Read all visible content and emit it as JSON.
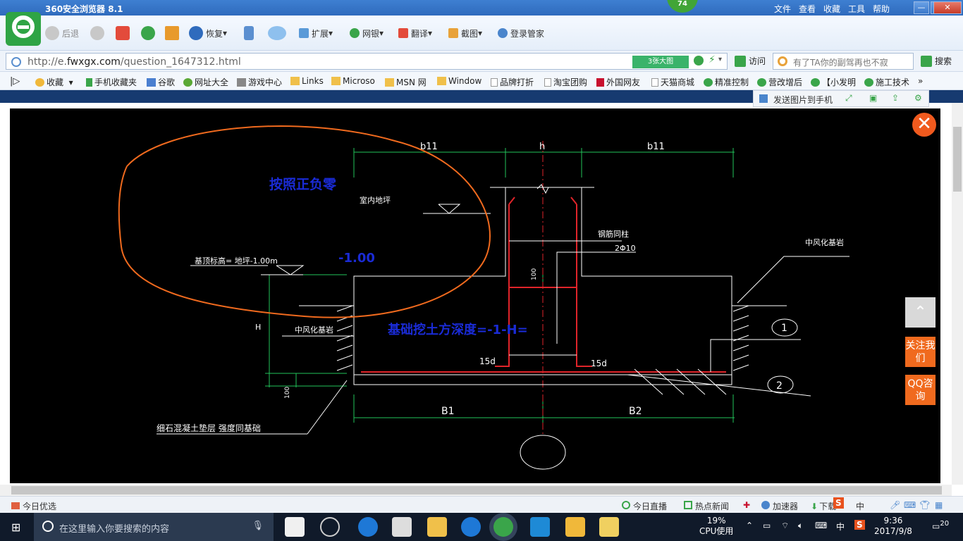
{
  "titlebar": {
    "title": "360安全浏览器 8.1",
    "badge": "74",
    "menu": [
      "文件",
      "查看",
      "收藏",
      "工具",
      "帮助"
    ]
  },
  "toolbar": {
    "back": "后退",
    "restore": "恢复",
    "extend": "扩展",
    "bank": "网银",
    "translate": "翻译",
    "screenshot": "截图",
    "login": "登录管家"
  },
  "address": {
    "url_prefix": "http://e.",
    "url_domain": "fwxgx.com",
    "url_path": "/question_1647312.html",
    "big_image": "3张大图",
    "visit": "访问",
    "search_placeholder": "有了TA你的副驾再也不寂",
    "search_btn": "搜索"
  },
  "favorites": [
    "收藏",
    "手机收藏夹",
    "谷歌",
    "网址大全",
    "游戏中心",
    "Links",
    "Microso",
    "MSN 网",
    "Window",
    "品牌打折",
    "淘宝团购",
    "外国网友",
    "天猫商城",
    "精准控制",
    "营改增后",
    "【小发明",
    "施工技术"
  ],
  "sendbar": {
    "label": "发送图片到手机"
  },
  "drawing": {
    "annot_text": "按照正负零",
    "annot_value": "-1.00",
    "annot_depth": "基础挖土方深度=-1-H=",
    "dim_b11_left": "b11",
    "dim_h": "h",
    "dim_b11_right": "b11",
    "indoor_floor": "室内地坪",
    "base_elev": "基顶标高= 地坪-1.00m",
    "steel_col": "钢筋同柱",
    "rebar": "2Φ10",
    "weathered_right": "中风化基岩",
    "weathered_left": "中风化基岩",
    "dim_100_top": "100",
    "dim_H": "H",
    "dim_100_bot": "100",
    "anchor_left": "15d",
    "anchor_right": "15d",
    "marker1": "1",
    "marker2": "2",
    "dim_B1": "B1",
    "dim_B2": "B2",
    "cushion": "细石混凝土垫层 强度同基础"
  },
  "side": {
    "follow": "关注我们",
    "qq": "QQ咨询"
  },
  "status": {
    "today": "今日优选",
    "live": "今日直播",
    "news": "热点新闻",
    "accel": "加速器",
    "download": "下载"
  },
  "taskbar": {
    "search": "在这里输入你要搜索的内容",
    "cpu_pct": "19%",
    "cpu_label": "CPU使用",
    "ime": "中",
    "time": "9:36",
    "date": "2017/9/8",
    "notif": "20"
  },
  "colors": {
    "annot_blue": "#1a2bd6",
    "annot_orange": "#f06a1e",
    "green_dim": "#22c35a",
    "red_rebar": "#e0242a"
  }
}
